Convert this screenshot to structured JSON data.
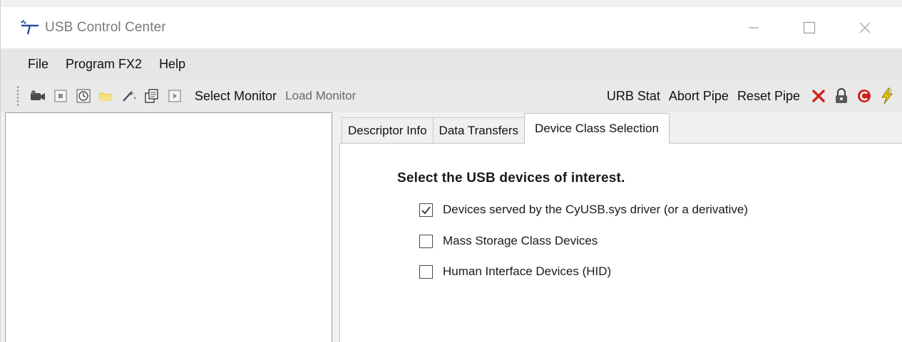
{
  "window": {
    "title": "USB Control Center",
    "icon": "usb-app-icon"
  },
  "menu": [
    "File",
    "Program FX2",
    "Help"
  ],
  "toolbar": {
    "select_monitor": "Select Monitor",
    "load_monitor": "Load Monitor",
    "urb_stat": "URB Stat",
    "abort_pipe": "Abort Pipe",
    "reset_pipe": "Reset Pipe",
    "left_icons": [
      "camera-icon",
      "stop-icon",
      "refresh-clock-icon",
      "folder-icon",
      "wand-icon",
      "documents-icon",
      "play-icon"
    ],
    "right_icons": [
      "red-x-icon",
      "lock-icon",
      "reset-c-icon",
      "lightning-icon"
    ]
  },
  "tabs": [
    "Descriptor Info",
    "Data Transfers",
    "Device Class Selection"
  ],
  "active_tab": "Device Class Selection",
  "panel": {
    "heading": "Select the USB devices of interest.",
    "options": [
      {
        "label": "Devices served by the CyUSB.sys driver (or a derivative)",
        "checked": true
      },
      {
        "label": "Mass Storage Class Devices",
        "checked": false
      },
      {
        "label": "Human Interface Devices (HID)",
        "checked": false
      }
    ]
  },
  "colors": {
    "title_text": "#7a7a7a",
    "menubar_bg": "#e6e6e6",
    "toolbar_bg": "#e9e9e9",
    "accent_red": "#d21f1f",
    "accent_yellow": "#e8c400"
  }
}
